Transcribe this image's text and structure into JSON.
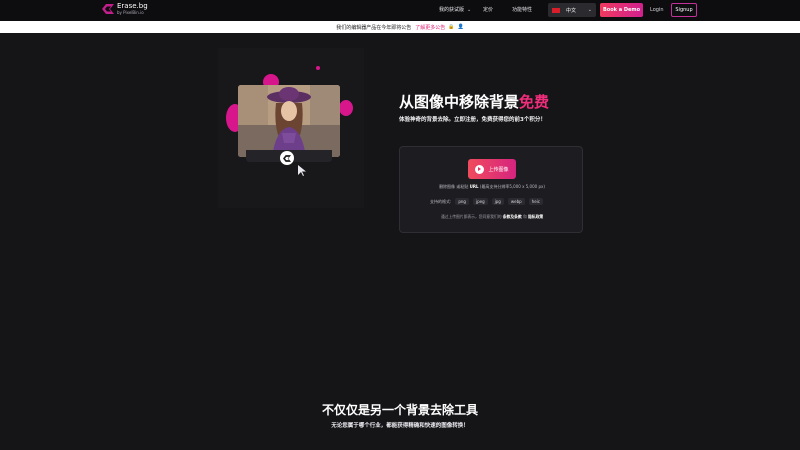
{
  "nav": {
    "logo_name": "Erase.bg",
    "logo_sub": "by PixelBin.io",
    "menu": [
      {
        "label": "我的获试版",
        "has_chevron": true
      },
      {
        "label": "定价",
        "has_chevron": false
      },
      {
        "label": "功能特性",
        "has_chevron": false
      }
    ],
    "language": "中文",
    "book_demo": "Book a Demo",
    "login": "Login",
    "signup": "Signup"
  },
  "banner": {
    "text": "我们的编辑器产品在今年即将公告",
    "link": "了解更多公告"
  },
  "hero": {
    "title_main": "从图像中移除背景",
    "title_accent": "免费",
    "subtitle": "体验神奇的背景去除。立即注册，免费获得您的前3个积分！"
  },
  "upload": {
    "button": "上传图像",
    "hint_prefix": "删除图像 或粘贴",
    "hint_url": "URL",
    "hint_suffix": "(最高支持分辨率5,000 x 5,000 px)",
    "formats_label": "支持的格式:",
    "formats": [
      "png",
      "jpeg",
      "jpg",
      "webp",
      "heic"
    ],
    "note_prefix": "通过上传图片即表示，您同意我们的",
    "note_terms": "条款及条款",
    "note_and": "和",
    "note_privacy": "隐私政策"
  },
  "section2": {
    "title": "不仅仅是另一个背景去除工具",
    "subtitle": "无论您属于哪个行业，都能获得精确和快速的图像转换！"
  },
  "colors": {
    "accent": "#f02d7a",
    "brand_gradient_start": "#f03a5f",
    "brand_gradient_end": "#d1208f",
    "background": "#151518"
  },
  "icons": [
    "logo-mark-icon",
    "chevron-down-icon",
    "flag-cn-icon",
    "lock-icon",
    "upload-icon",
    "eraser-icon",
    "cursor-arrow-icon"
  ]
}
